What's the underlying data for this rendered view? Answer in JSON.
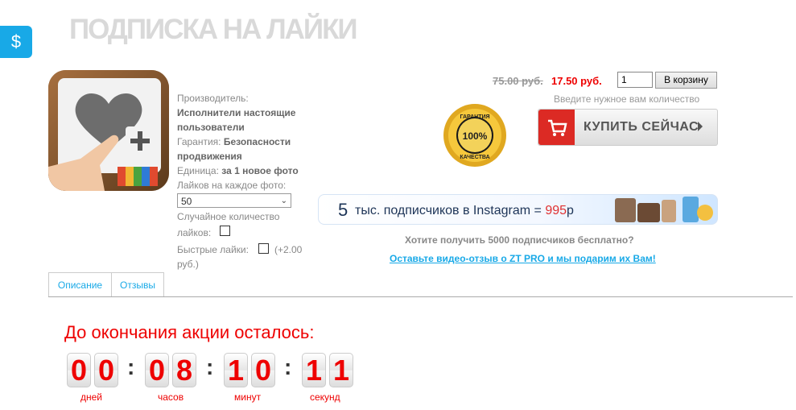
{
  "header": {
    "title": "ПОДПИСКА НА ЛАЙКИ",
    "dollar_icon_symbol": "$"
  },
  "product_info": {
    "maker_label": "Производитель:",
    "maker_value_1": "Исполнители настоящие",
    "maker_value_2": "пользователи",
    "guarantee_label": "Гарантия:",
    "guarantee_value_1": "Безопасности",
    "guarantee_value_2": "продвижения",
    "unit_label": "Единица:",
    "unit_value": "за 1 новое фото",
    "likes_label": "Лайков на каждое фото:",
    "likes_selected": "50",
    "random_label_1": "Случайное количество",
    "random_label_2": "лайков:",
    "fast_label": "Быстрые лайки:",
    "fast_extra_1": "(+2.00",
    "fast_extra_2": "руб.)"
  },
  "purchase": {
    "old_price": "75.00 руб.",
    "new_price": "17.50 руб.",
    "quantity": "1",
    "add_to_cart": "В корзину",
    "quantity_hint": "Введите нужное вам количество",
    "buy_now": "КУПИТЬ СЕЙЧАС",
    "seal_line1": "ГАРАНТИЯ",
    "seal_percent": "100%",
    "seal_line2": "КАЧЕСТВА"
  },
  "banner": {
    "number": "5",
    "text": "тыс. подписчиков в Instagram =",
    "price": "995",
    "currency": "р"
  },
  "promo": {
    "question": "Хотите получить 5000 подписчиков бесплатно?",
    "link": "Оставьте видео-отзыв о ZT PRO и мы подарим их Вам!"
  },
  "tabs": [
    "Описание",
    "Отзывы"
  ],
  "countdown": {
    "title": "До окончания акции осталось:",
    "digits": [
      "0",
      "0",
      "0",
      "8",
      "1",
      "0",
      "1",
      "1"
    ],
    "units": [
      "дней",
      "часов",
      "минут",
      "секунд"
    ]
  },
  "colors": {
    "accent": "#18a9e7",
    "red": "#dc2a24",
    "price_red": "#e00000"
  }
}
